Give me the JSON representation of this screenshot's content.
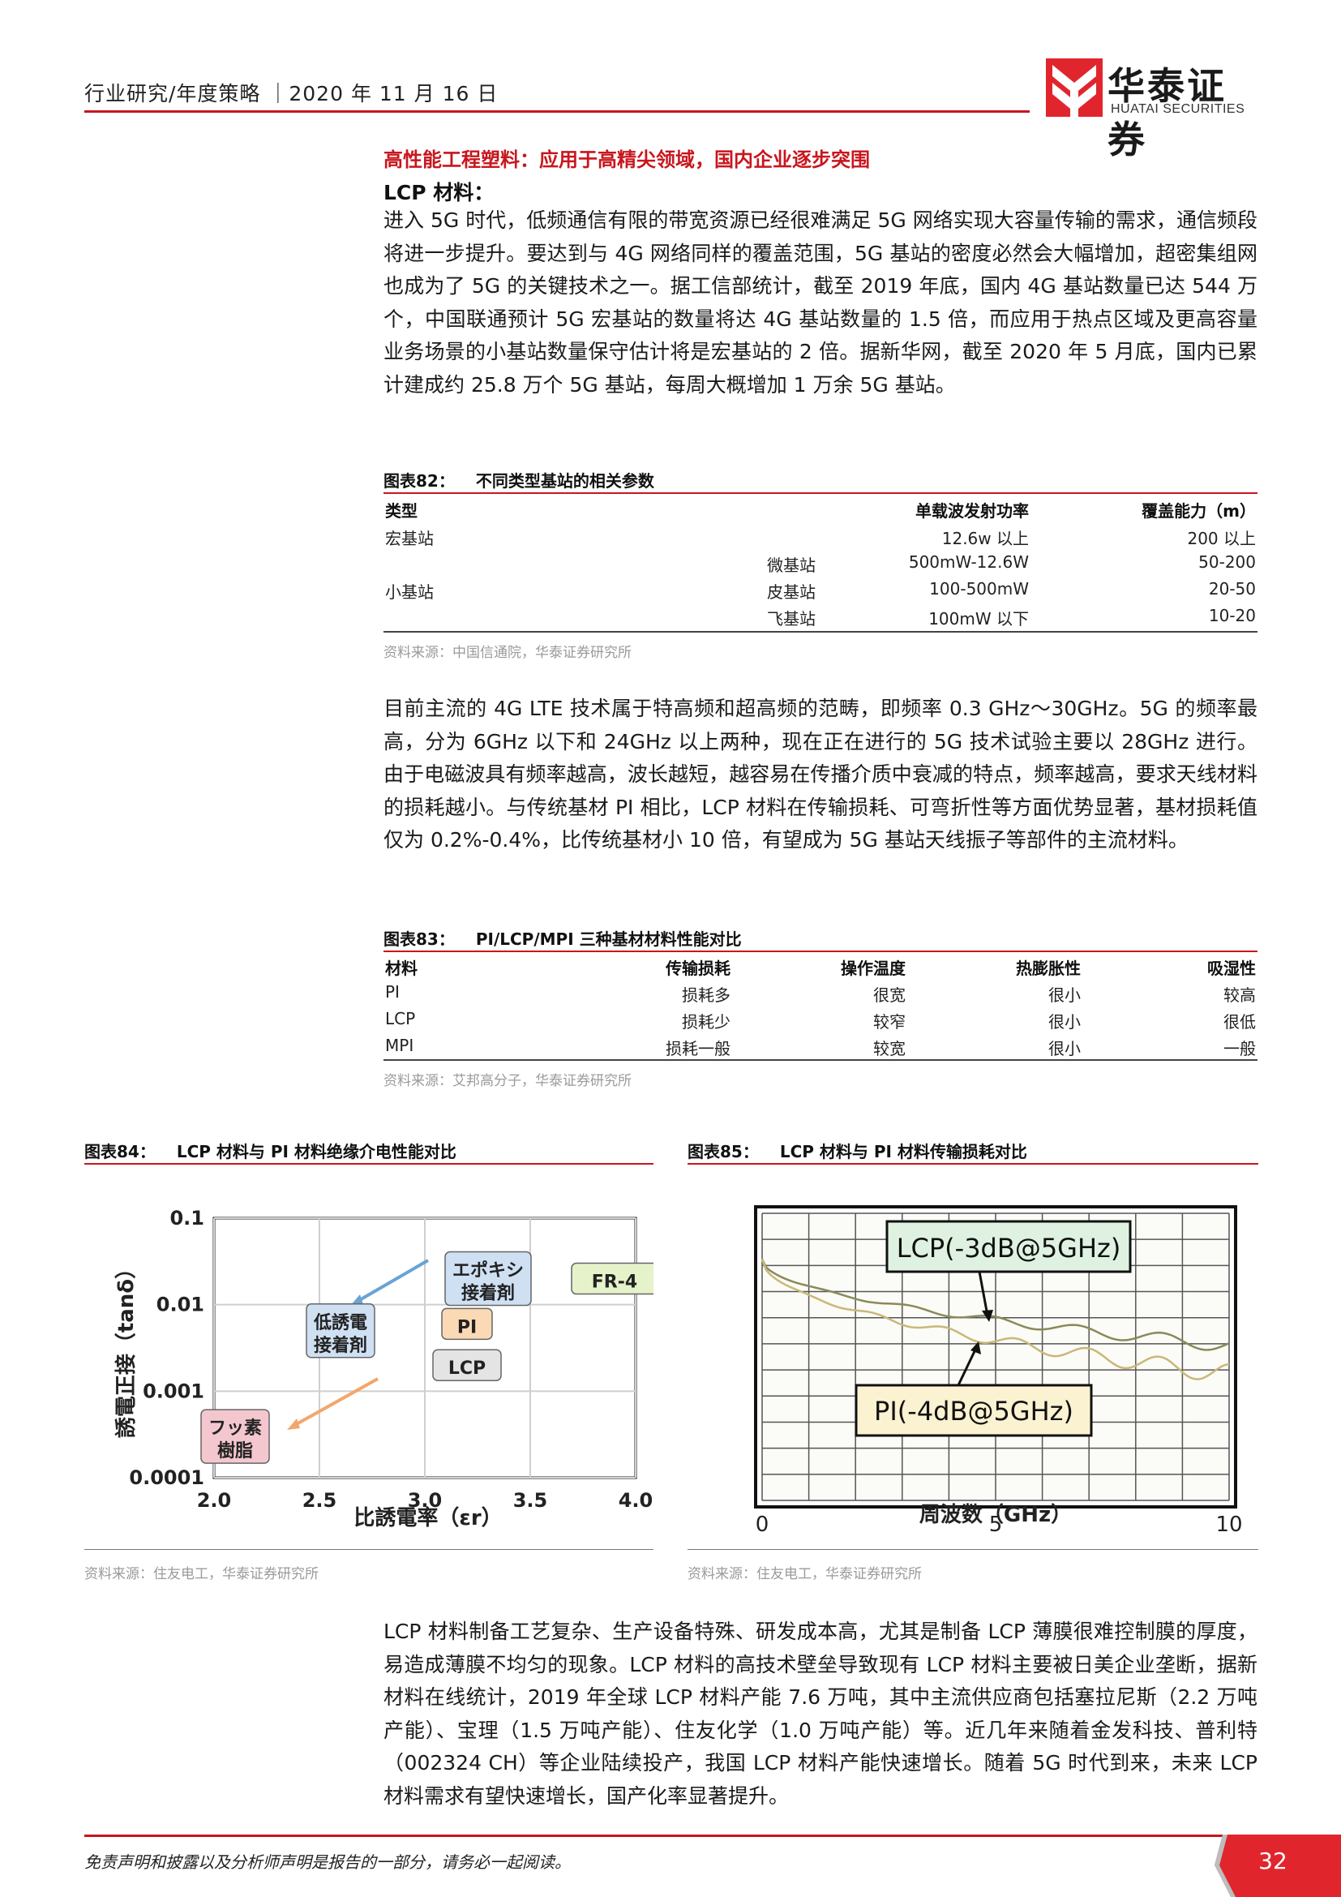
{
  "header": {
    "text": "行业研究/年度策略 ｜2020 年 11 月 16 日",
    "logo_cn": "华泰证券",
    "logo_en": "HUATAI SECURITIES"
  },
  "section": {
    "title": "高性能工程塑料：应用于高精尖领域，国内企业逐步突围",
    "subtitle": "LCP 材料："
  },
  "paragraphs": [
    "进入 5G 时代，低频通信有限的带宽资源已经很难满足 5G 网络实现大容量传输的需求，通信频段将进一步提升。要达到与 4G 网络同样的覆盖范围，5G 基站的密度必然会大幅增加，超密集组网也成为了 5G 的关键技术之一。据工信部统计，截至 2019 年底，国内 4G 基站数量已达 544 万个，中国联通预计 5G 宏基站的数量将达 4G 基站数量的 1.5 倍，而应用于热点区域及更高容量业务场景的小基站数量保守估计将是宏基站的 2 倍。据新华网，截至 2020 年 5 月底，国内已累计建成约 25.8 万个 5G 基站，每周大概增加 1 万余 5G 基站。",
    "目前主流的 4G LTE 技术属于特高频和超高频的范畴，即频率 0.3 GHz～30GHz。5G 的频率最高，分为 6GHz 以下和 24GHz 以上两种，现在正在进行的 5G 技术试验主要以 28GHz 进行。由于电磁波具有频率越高，波长越短，越容易在传播介质中衰减的特点，频率越高，要求天线材料的损耗越小。与传统基材 PI 相比，LCP 材料在传输损耗、可弯折性等方面优势显著，基材损耗值仅为 0.2%-0.4%，比传统基材小 10 倍，有望成为 5G 基站天线振子等部件的主流材料。",
    "LCP 材料制备工艺复杂、生产设备特殊、研发成本高，尤其是制备 LCP 薄膜很难控制膜的厚度，易造成薄膜不均匀的现象。LCP 材料的高技术壁垒导致现有 LCP 材料主要被日美企业垄断，据新材料在线统计，2019 年全球 LCP 材料产能 7.6 万吨，其中主流供应商包括塞拉尼斯（2.2 万吨产能）、宝理（1.5 万吨产能）、住友化学（1.0 万吨产能）等。近几年来随着金发科技、普利特（002324 CH）等企业陆续投产，我国 LCP 材料产能快速增长。随着 5G 时代到来，未来 LCP 材料需求有望快速增长，国产化率显著提升。"
  ],
  "table82": {
    "num": "图表82：",
    "title": "不同类型基站的相关参数",
    "headers": [
      "类型",
      "单载波发射功率",
      "覆盖能力（m）"
    ],
    "rows": [
      {
        "type": "宏基站",
        "sub": "",
        "power": "12.6w 以上",
        "cover": "200 以上"
      },
      {
        "type": "",
        "sub": "微基站",
        "power": "500mW-12.6W",
        "cover": "50-200"
      },
      {
        "type": "小基站",
        "sub": "皮基站",
        "power": "100-500mW",
        "cover": "20-50"
      },
      {
        "type": "",
        "sub": "飞基站",
        "power": "100mW 以下",
        "cover": "10-20"
      }
    ],
    "source": "资料来源：中国信通院，华泰证券研究所"
  },
  "table83": {
    "num": "图表83：",
    "title": "PI/LCP/MPI 三种基材材料性能对比",
    "headers": [
      "材料",
      "传输损耗",
      "操作温度",
      "热膨胀性",
      "吸湿性"
    ],
    "rows": [
      [
        "PI",
        "损耗多",
        "很宽",
        "很小",
        "较高"
      ],
      [
        "LCP",
        "损耗少",
        "较窄",
        "很小",
        "很低"
      ],
      [
        "MPI",
        "损耗一般",
        "较宽",
        "很小",
        "一般"
      ]
    ],
    "source": "资料来源：艾邦高分子，华泰证券研究所"
  },
  "fig84": {
    "num": "图表84：",
    "title": "LCP 材料与 PI 材料绝缘介电性能对比",
    "source": "资料来源：住友电工，华泰证券研究所",
    "chart_data": {
      "type": "scatter",
      "xlabel": "比誘電率（εr）",
      "ylabel": "誘電正接（tanδ）",
      "x_ticks": [
        "2.0",
        "2.5",
        "3.0",
        "3.5",
        "4.0"
      ],
      "y_ticks": [
        "0.1",
        "0.01",
        "0.001",
        "0.0001"
      ],
      "xlim": [
        2.0,
        4.0
      ],
      "ylim": [
        0.0001,
        0.1
      ],
      "y_scale": "log",
      "points": [
        {
          "label": "フッ素\n樹脂",
          "x": 2.1,
          "y": 0.0003,
          "color": "#f4c7cf"
        },
        {
          "label": "LCP",
          "x": 3.2,
          "y": 0.002,
          "color": "#e4e4e4"
        },
        {
          "label": "PI",
          "x": 3.2,
          "y": 0.006,
          "color": "#fbd9b5"
        },
        {
          "label": "低誘電\n接着剤",
          "x": 2.6,
          "y": 0.005,
          "color": "#cfe0f3"
        },
        {
          "label": "エポキシ\n接着剤",
          "x": 3.3,
          "y": 0.02,
          "color": "#cfe0f3"
        },
        {
          "label": "FR-4",
          "x": 3.9,
          "y": 0.02,
          "color": "#e6f2c9"
        }
      ]
    }
  },
  "fig85": {
    "num": "图表85：",
    "title": "LCP 材料与 PI 材料传输损耗对比",
    "source": "资料来源：住友电工，华泰证券研究所",
    "chart_data": {
      "type": "line",
      "xlabel": "周波数（GHz）",
      "x_ticks": [
        "0",
        "5",
        "10"
      ],
      "xlim": [
        0,
        10
      ],
      "series": [
        {
          "name": "LCP(-3dB@5GHz)",
          "color": "#8a8a5a"
        },
        {
          "name": "PI(-4dB@5GHz)",
          "color": "#c9b87a"
        }
      ],
      "annotations": [
        "LCP(-3dB@5GHz)",
        "PI(-4dB@5GHz)"
      ]
    }
  },
  "footer": {
    "disclaimer": "免责声明和披露以及分析师声明是报告的一部分，请务必一起阅读。",
    "page": "32"
  }
}
